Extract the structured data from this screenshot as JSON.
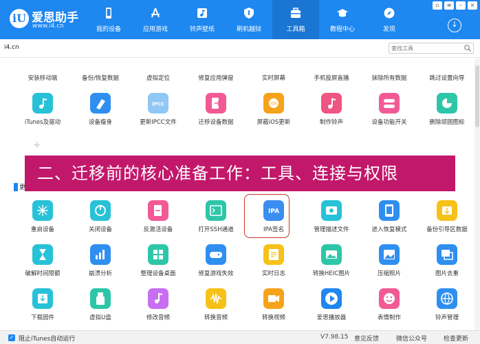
{
  "app": {
    "logo_name": "爱思助手",
    "logo_url": "www.i4.cn",
    "logo_mark": "iU"
  },
  "nav": [
    {
      "label": "我的设备",
      "icon": "phone-icon"
    },
    {
      "label": "应用游戏",
      "icon": "appstore-icon"
    },
    {
      "label": "铃声壁纸",
      "icon": "music-icon"
    },
    {
      "label": "刷机越狱",
      "icon": "shield-icon"
    },
    {
      "label": "工具箱",
      "icon": "toolbox-icon"
    },
    {
      "label": "教程中心",
      "icon": "graduation-icon"
    },
    {
      "label": "发现",
      "icon": "compass-icon"
    }
  ],
  "tab": {
    "label": "i4.cn"
  },
  "search": {
    "placeholder": "查找工具"
  },
  "top_row_labels": [
    "安装移动端",
    "备份/恢复数据",
    "虚拟定位",
    "修复应用弹窗",
    "实时屏幕",
    "手机投屏直播",
    "抹除所有数据",
    "跳过设置向导"
  ],
  "plus_label": "+",
  "section_stub": "更",
  "banner": {
    "text": "二、迁移前的核心准备工作：工具、连接与权限"
  },
  "rows": [
    [
      {
        "label": "iTunes及驱动",
        "color": "#27c2d8",
        "icon": "music-note-icon"
      },
      {
        "label": "设备瘦身",
        "color": "#2f8ff0",
        "icon": "broom-icon"
      },
      {
        "label": "更新IPCC文件",
        "color": "#8fc7f5",
        "icon": "ipcc-icon",
        "glyph": "IPCC"
      },
      {
        "label": "迁移设备数据",
        "color": "#f25a95",
        "icon": "transfer-icon"
      },
      {
        "label": "屏蔽iOS更新",
        "color": "#f6a21a",
        "icon": "gear-block-icon"
      },
      {
        "label": "制作铃声",
        "color": "#ef5483",
        "icon": "music-note-icon"
      },
      {
        "label": "设备功能开关",
        "color": "#f25a95",
        "icon": "toggle-icon"
      },
      {
        "label": "删除顽固图标",
        "color": "#2ec6a8",
        "icon": "pie-icon"
      }
    ],
    [
      {
        "label": "重启设备",
        "color": "#27c2d8",
        "icon": "restart-icon"
      },
      {
        "label": "关闭设备",
        "color": "#27c2d8",
        "icon": "power-icon"
      },
      {
        "label": "反激活设备",
        "color": "#f25a95",
        "icon": "deactivate-icon"
      },
      {
        "label": "打开SSH通道",
        "color": "#2ec6a8",
        "icon": "terminal-icon"
      },
      {
        "label": "IPA签名",
        "color": "#3a8ef0",
        "icon": "ipa-icon",
        "glyph": "IPA"
      },
      {
        "label": "管理描述文件",
        "color": "#27c2d8",
        "icon": "profile-icon"
      },
      {
        "label": "进入恢复模式",
        "color": "#2f8ff0",
        "icon": "recovery-icon"
      },
      {
        "label": "备份引导区数据",
        "color": "#f6c21a",
        "icon": "backup-icon"
      }
    ],
    [
      {
        "label": "破解时间限额",
        "color": "#27c2d8",
        "icon": "hourglass-icon"
      },
      {
        "label": "崩溃分析",
        "color": "#2f8ff0",
        "icon": "chart-icon"
      },
      {
        "label": "整理设备桌面",
        "color": "#2ec6a8",
        "icon": "grid-icon"
      },
      {
        "label": "修复游戏失效",
        "color": "#2f8ff0",
        "icon": "gamepad-icon"
      },
      {
        "label": "实时日志",
        "color": "#f6c21a",
        "icon": "log-icon"
      },
      {
        "label": "转换HEIC图片",
        "color": "#2ec6a8",
        "icon": "image-icon"
      },
      {
        "label": "压缩照片",
        "color": "#2f8ff0",
        "icon": "photo-icon"
      },
      {
        "label": "图片去重",
        "color": "#2f8ff0",
        "icon": "dedup-icon"
      }
    ],
    [
      {
        "label": "下载固件",
        "color": "#27c2d8",
        "icon": "download-icon"
      },
      {
        "label": "虚拟U盘",
        "color": "#2ec6a8",
        "icon": "usb-icon"
      },
      {
        "label": "修改音频",
        "color": "#c86ef0",
        "icon": "audio-icon"
      },
      {
        "label": "转换音频",
        "color": "#f6c21a",
        "icon": "waveform-icon"
      },
      {
        "label": "转换视频",
        "color": "#f6a21a",
        "icon": "video-icon"
      },
      {
        "label": "爱思播放器",
        "color": "#1e87f0",
        "icon": "play-icon"
      },
      {
        "label": "表情制作",
        "color": "#f25a95",
        "icon": "emoji-icon"
      },
      {
        "label": "铃声管理",
        "color": "#2f8ff0",
        "icon": "globe-icon"
      }
    ]
  ],
  "status": {
    "checkbox_label": "阻止iTunes自动运行",
    "version": "V7.98.15",
    "feedback": "意见反馈",
    "wechat": "微信公众号",
    "update": "检查更新"
  }
}
